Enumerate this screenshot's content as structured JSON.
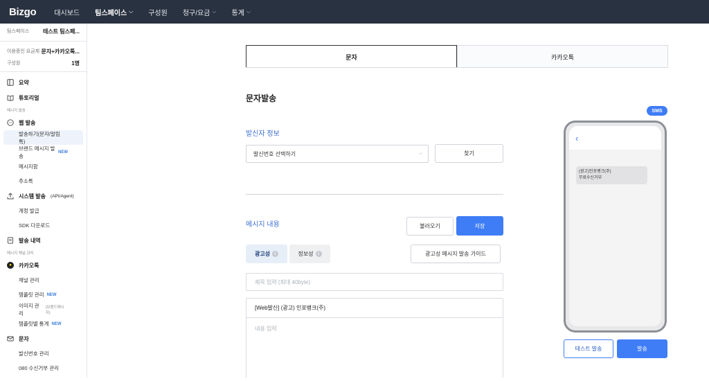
{
  "header": {
    "logo": "Bizgo",
    "nav": [
      {
        "label": "대시보드",
        "chevron": false,
        "active": false
      },
      {
        "label": "팀스페이스",
        "chevron": true,
        "active": true
      },
      {
        "label": "구성원",
        "chevron": false,
        "active": false
      },
      {
        "label": "청구/요금",
        "chevron": true,
        "active": false
      },
      {
        "label": "통계",
        "chevron": true,
        "active": false
      }
    ]
  },
  "sidebar": {
    "teamspace_label": "팀스페이스",
    "teamspace_value": "테스트 팀스페...",
    "plan_label": "이용중인 요금제",
    "plan_value": "문자+카카오톡...",
    "members_label": "구성원",
    "members_value": "1명",
    "summary": "요약",
    "tutorial": "튜토리얼",
    "group_message": "메시지 발송",
    "web_send": "웹 발송",
    "web_items": {
      "send": "발송하기(문자/알림톡)",
      "brand": "브랜드 메시지 발송",
      "brand_badge": "NEW",
      "storage": "메시지함",
      "address": "주소록"
    },
    "system_send": "시스템 발송",
    "system_send_sub": "(API/Agent)",
    "system_items": {
      "account": "계정 발급",
      "sdk": "SDK 다운로드"
    },
    "history": "발송 내역",
    "group_channel": "메시지 채널 관리",
    "kakao": "카카오톡",
    "kakao_items": {
      "channel": "채널 관리",
      "template": "템플릿 관리",
      "template_badge": "NEW",
      "image": "이미지 관리",
      "image_note": "(브랜드메시지)",
      "stats": "템플릿별 통계",
      "stats_badge": "NEW"
    },
    "sms": "문자",
    "sms_items": {
      "sender": "발신번호 관리",
      "reject": "080 수신거부 관리"
    }
  },
  "tabs": {
    "sms": "문자",
    "kakao": "카카오톡"
  },
  "main": {
    "title": "문자발송",
    "sender_section": "발신자 정보",
    "sender_select": "발신번호 선택하기",
    "find_button": "찾기",
    "message_section": "메시지 내용",
    "load_button": "불러오기",
    "save_button": "저장",
    "ad_toggle": "광고성",
    "info_toggle": "정보성",
    "guide_button": "광고성 메시지 발송 가이드",
    "subject_placeholder": "제목 입력 (최대 40byte)",
    "message_prefix": "[Web발신] (광고)  인포뱅크(주)",
    "content_placeholder": "내용 입력"
  },
  "preview": {
    "badge": "SMS",
    "bubble_line1": "(광고)인포뱅크(주)",
    "bubble_line2": "무료수신거부",
    "test_button": "테스트 발송",
    "send_button": "발송"
  },
  "colors": {
    "accent": "#3f7df6",
    "topbar": "#293240",
    "section_title": "#3b6fd1"
  }
}
